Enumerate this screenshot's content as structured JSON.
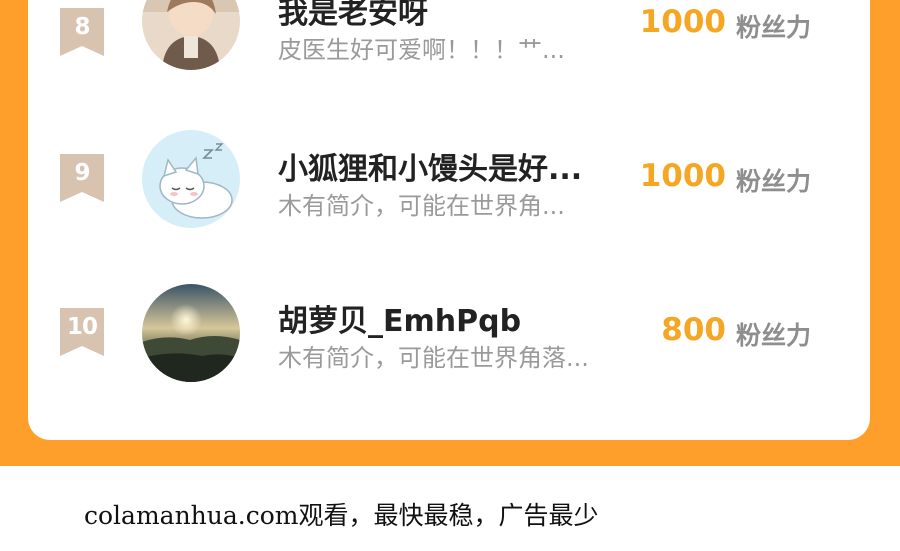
{
  "ranking": {
    "rows": [
      {
        "rank": "8",
        "name": "我是老安呀",
        "bio": "皮医生好可爱啊！！！艹...",
        "score": "1000",
        "unit": "粉丝力",
        "avatar": "anime-character-avatar"
      },
      {
        "rank": "9",
        "name": "小狐狸和小馒头是好...",
        "bio": "木有简介，可能在世界角...",
        "score": "1000",
        "unit": "粉丝力",
        "avatar": "sleeping-white-cat-avatar"
      },
      {
        "rank": "10",
        "name": "胡萝贝_EmhPqb",
        "bio": "木有简介，可能在世界角落...",
        "score": "800",
        "unit": "粉丝力",
        "avatar": "sunset-landscape-avatar"
      }
    ]
  },
  "footer": {
    "text": "colamanhua.com观看，最快最稳，广告最少"
  },
  "colors": {
    "frame": "#FF9F2B",
    "score": "#F5A623",
    "rank_badge": "#D7C3B0"
  }
}
